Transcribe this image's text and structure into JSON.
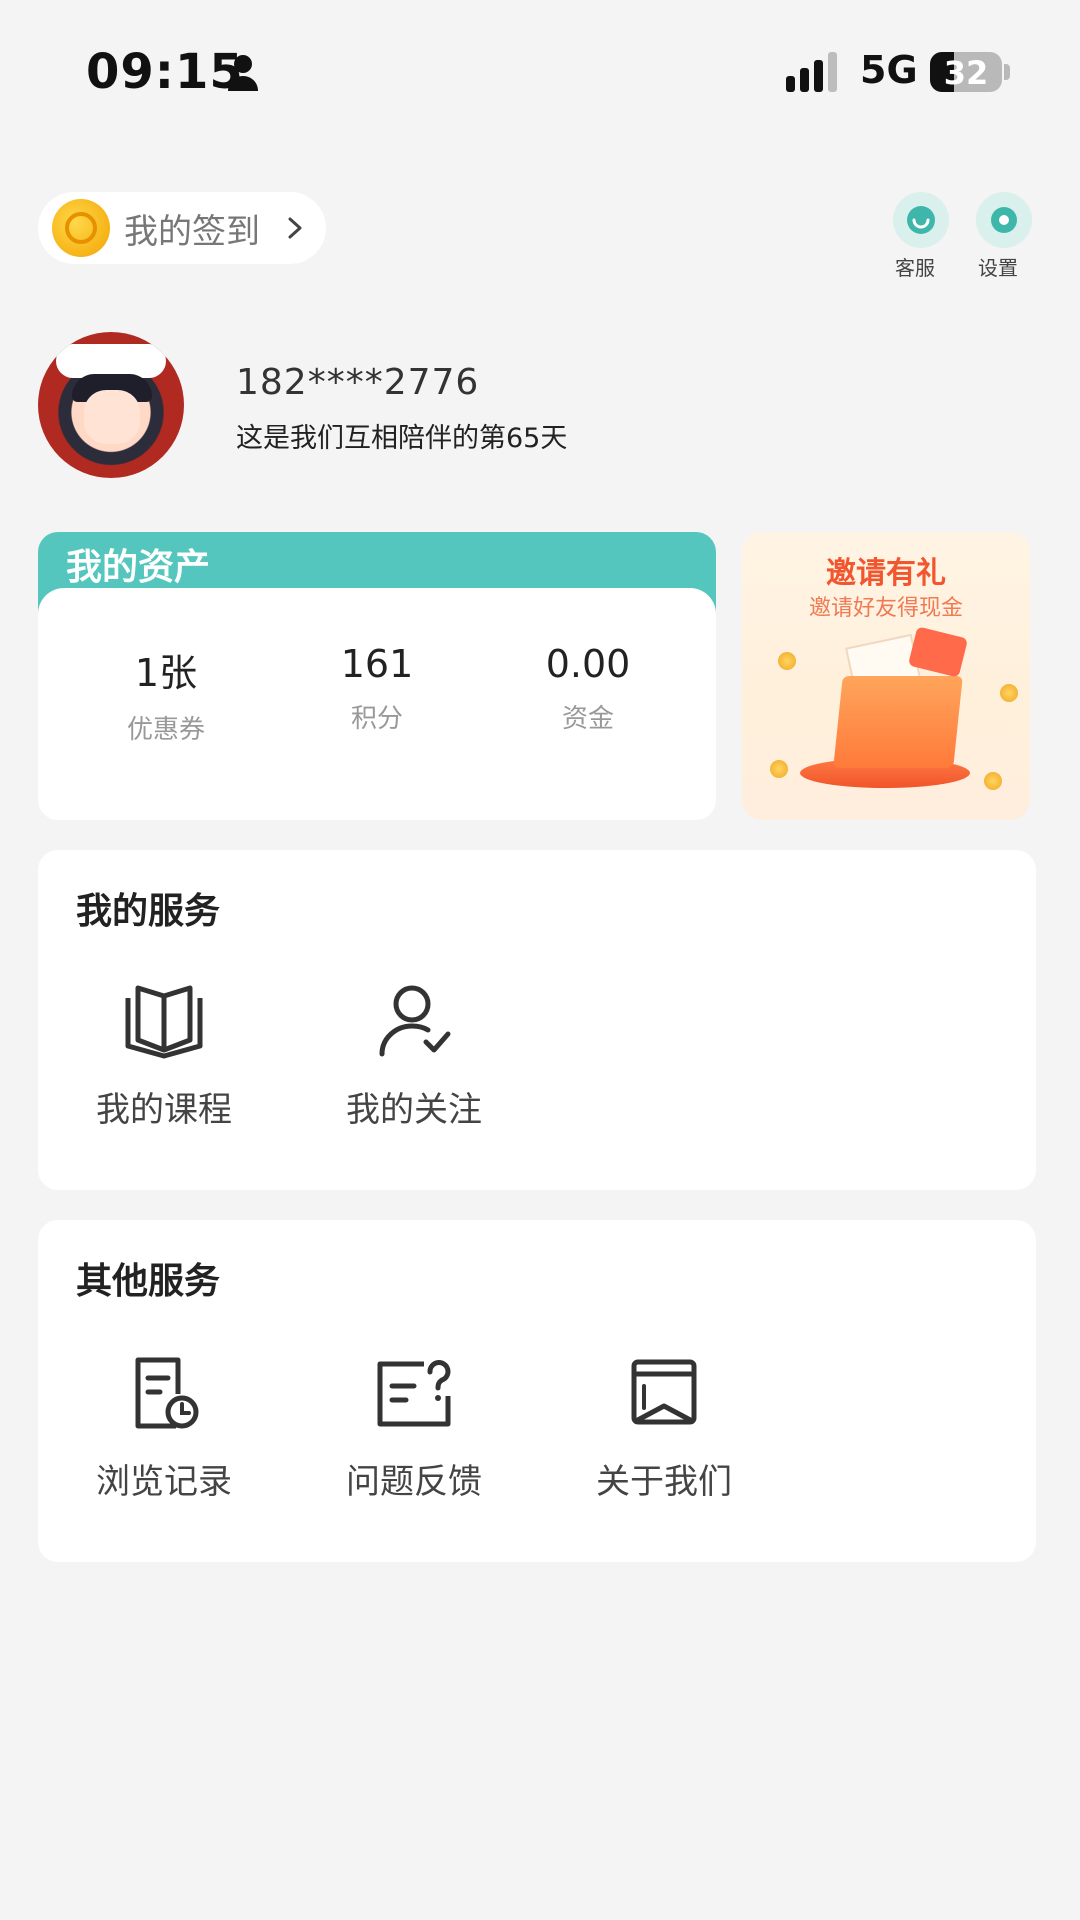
{
  "status_bar": {
    "time": "09:15",
    "network": "5G",
    "battery": "32"
  },
  "header": {
    "checkin_label": "我的签到",
    "customer_service_label": "客服",
    "settings_label": "设置"
  },
  "profile": {
    "phone": "182****2776",
    "tagline": "这是我们互相陪伴的第65天"
  },
  "assets": {
    "title": "我的资产",
    "items": [
      {
        "value": "1张",
        "label": "优惠券"
      },
      {
        "value": "161",
        "label": "积分"
      },
      {
        "value": "0.00",
        "label": "资金"
      }
    ]
  },
  "invite": {
    "title": "邀请有礼",
    "subtitle": "邀请好友得现金"
  },
  "my_services": {
    "title": "我的服务",
    "items": [
      {
        "label": "我的课程",
        "icon": "book-icon"
      },
      {
        "label": "我的关注",
        "icon": "user-check-icon"
      }
    ]
  },
  "other_services": {
    "title": "其他服务",
    "items": [
      {
        "label": "浏览记录",
        "icon": "history-icon"
      },
      {
        "label": "问题反馈",
        "icon": "feedback-icon"
      },
      {
        "label": "关于我们",
        "icon": "about-icon"
      }
    ]
  },
  "colors": {
    "accent": "#54c6bd",
    "background": "#f4f4f4",
    "invite_red": "#f2562e"
  }
}
